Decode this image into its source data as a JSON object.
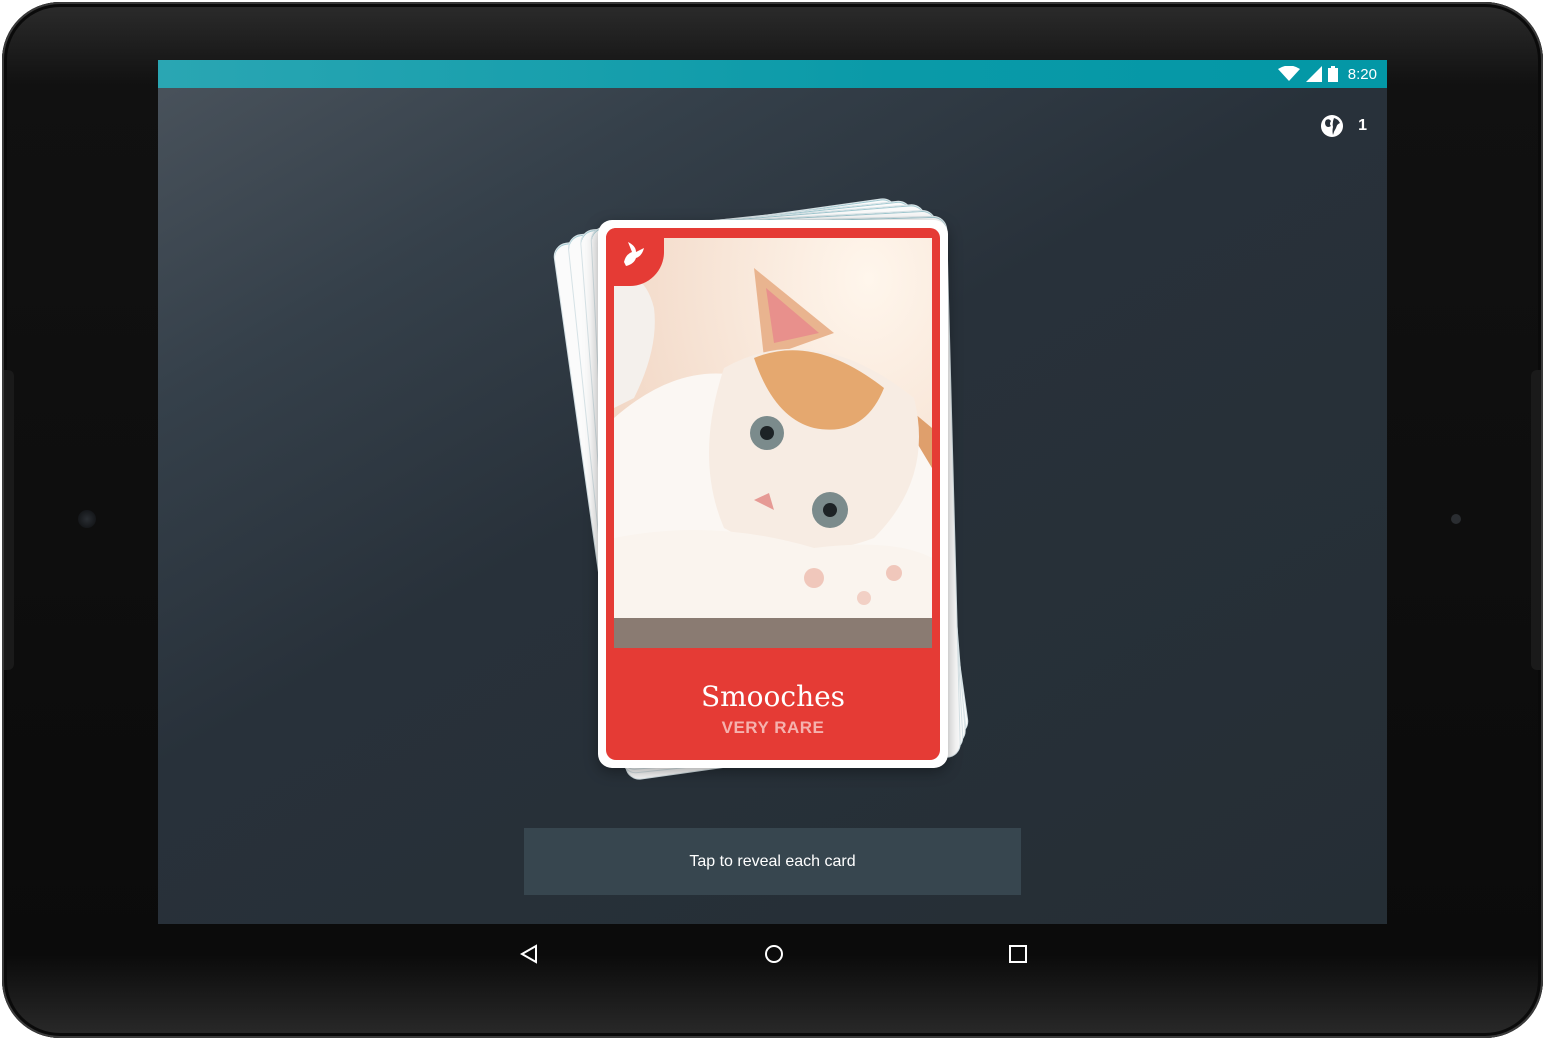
{
  "status_bar": {
    "time": "8:20",
    "icons": [
      "wifi-icon",
      "cell-signal-icon",
      "battery-icon"
    ],
    "color": "#0a9aa8"
  },
  "header": {
    "globe_icon": "globe-icon",
    "count": "1"
  },
  "card": {
    "name": "Smooches",
    "rarity": "VERY RARE",
    "badge_icon": "bird-icon",
    "color": "#e53b35",
    "image": "kitten-photo"
  },
  "action": {
    "label": "Tap to reveal each card"
  },
  "nav_bar": {
    "buttons": [
      "back-icon",
      "home-icon",
      "recents-icon"
    ]
  }
}
